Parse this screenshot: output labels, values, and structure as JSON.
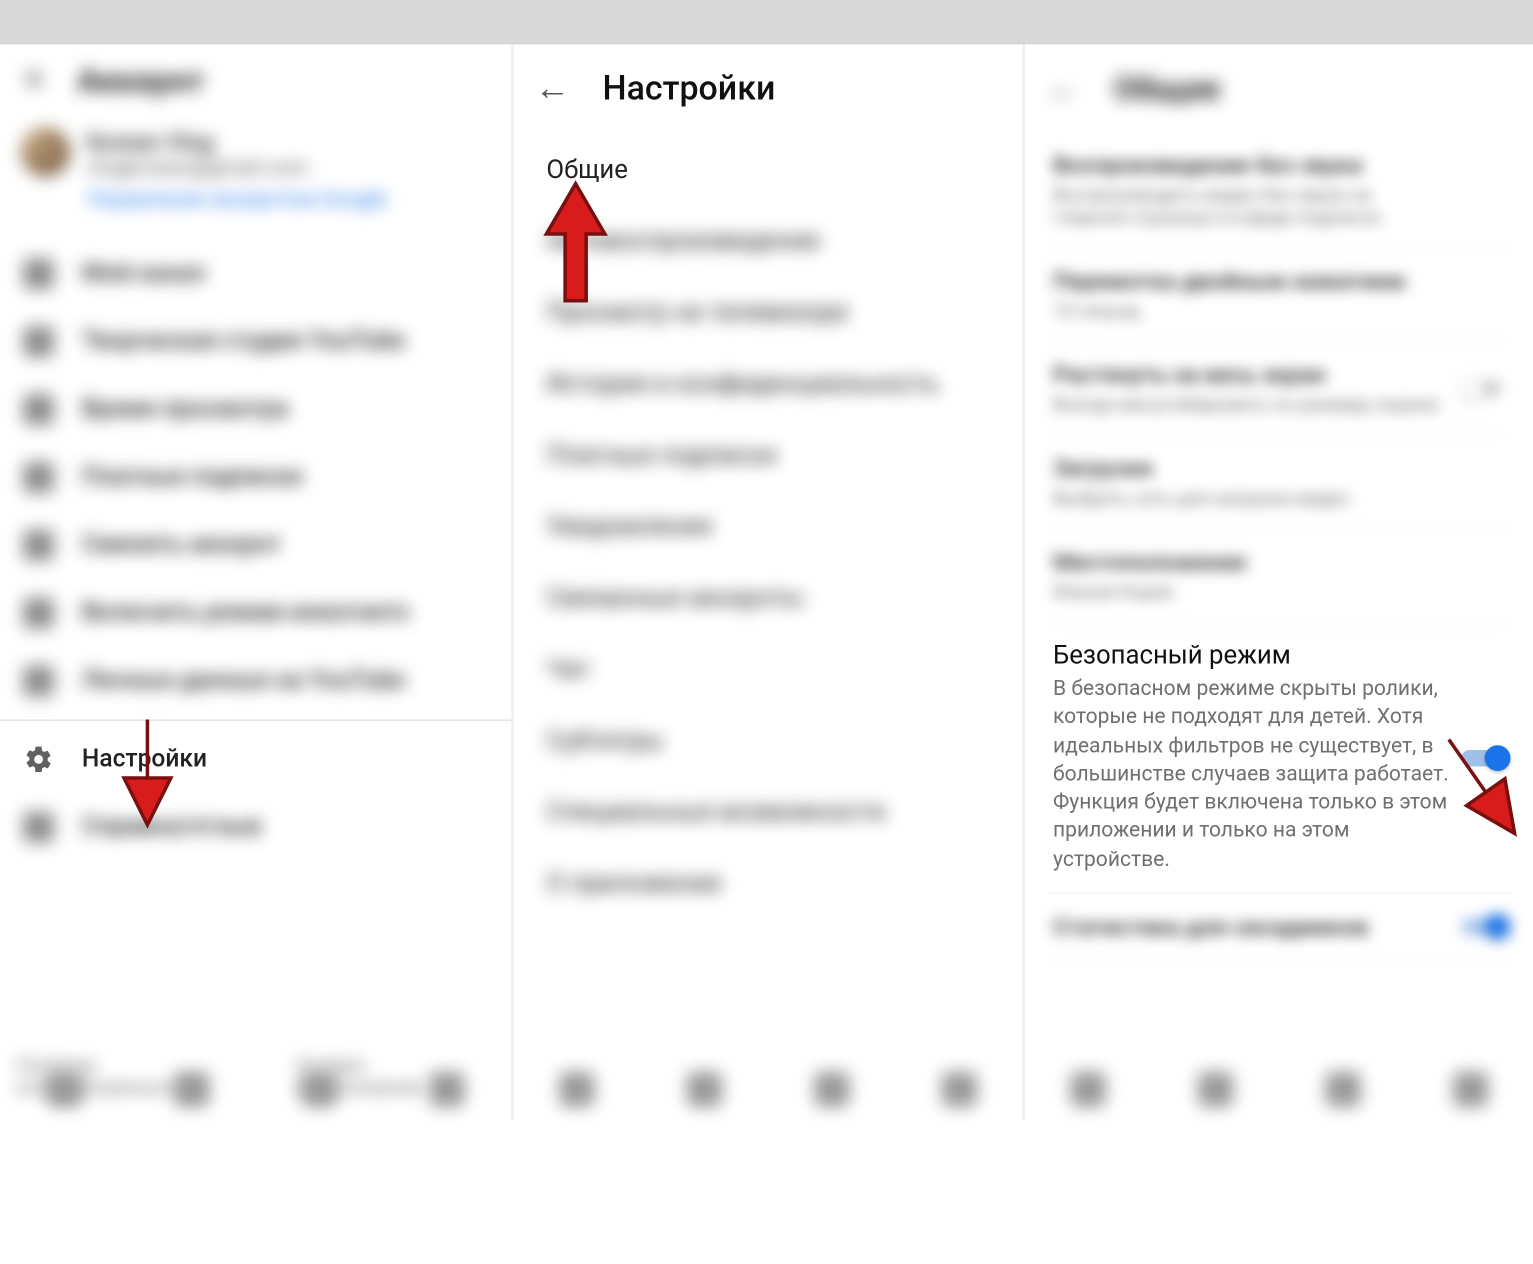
{
  "colors": {
    "accent": "#1a73e8",
    "arrow": "#d81b1b"
  },
  "panel1": {
    "title": "Аккаунт",
    "user_name": "Korean Vlog",
    "user_email": "vlogkorean@gmail.com",
    "manage_link": "Управление аккаунтом Google",
    "items_blur": [
      "Мой канал",
      "Творческая студия YouTube",
      "Время просмотра",
      "Платные подписки",
      "Сменить аккаунт",
      "Включить режим инкогнито",
      "Личные данные на YouTube"
    ],
    "settings_label": "Настройки",
    "after_settings": "Справка/отзыв",
    "footer1": "Политика конфиденциальности",
    "footer2": "Условия использования"
  },
  "panel2": {
    "title": "Настройки",
    "general_label": "Общие",
    "items_blur": [
      "Автовоспроизведение",
      "Просмотр на телевизоре",
      "История и конфиденциальность",
      "Платные подписки",
      "Уведомления",
      "Связанные аккаунты",
      "Чат",
      "Субтитры",
      "Специальные возможности",
      "О приложении"
    ]
  },
  "panel3": {
    "title": "Общие",
    "items_blur_top": [
      {
        "title": "Воспроизведение без звука",
        "sub": "Воспроизводить видео без звука на главной странице и в фиде подписок"
      },
      {
        "title": "Перемотка двойным нажатием",
        "sub": "10 секунд"
      },
      {
        "title": "Растянуть на весь экран",
        "sub": "Всегда масштабировать по размеру экрана",
        "toggle": "off"
      },
      {
        "title": "Загрузки",
        "sub": "Выбрать сеть для загрузки видео"
      },
      {
        "title": "Местоположение",
        "sub": "Южная Корея"
      }
    ],
    "safe_mode": {
      "title": "Безопасный режим",
      "desc": "В безопасном режиме скрыты ролики, которые не подходят для детей. Хотя идеальных фильтров не существует, в большинстве случаев защита работает. Функция будет включена только в этом приложении и только на этом устройстве.",
      "toggle": "on"
    },
    "items_blur_bottom": [
      {
        "title": "Статистика для сисадминов",
        "toggle": "on"
      }
    ]
  }
}
